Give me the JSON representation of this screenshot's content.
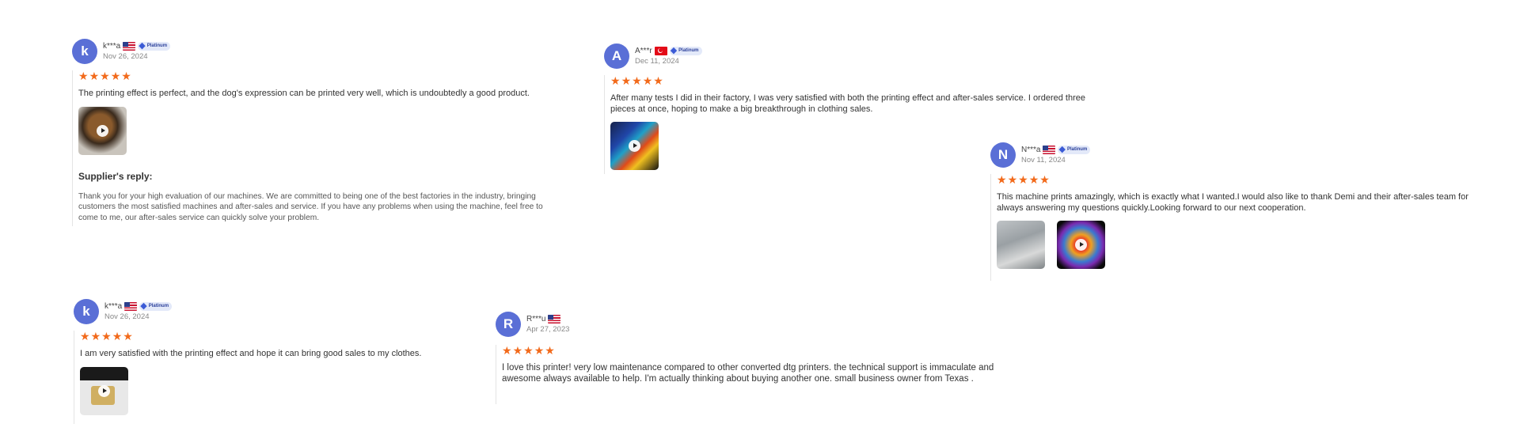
{
  "reviews": [
    {
      "avatar_letter": "k",
      "name": "k***a",
      "flag": "us-flag-icon",
      "badge": "Platinum",
      "date": "Nov 26, 2024",
      "rating": 5,
      "text": "The printing effect is perfect, and the dog's expression can be printed very well, which is undoubtedly a good product.",
      "reply": {
        "title": "Supplier's reply:",
        "text": "Thank you for your high evaluation of our machines. We are committed to being one of the best factories in the industry, bringing customers the most satisfied machines and after-sales and service. If you have any problems when using the machine, feel free to come to me, our after-sales service can quickly solve your problem."
      }
    },
    {
      "avatar_letter": "A",
      "name": "A***r",
      "flag": "turkey-flag-icon",
      "badge": "Platinum",
      "date": "Dec 11, 2024",
      "rating": 5,
      "text": "After many tests I did in their factory, I was very satisfied with both the printing effect and after-sales service. I ordered three pieces at once, hoping to make a big breakthrough in clothing sales."
    },
    {
      "avatar_letter": "N",
      "name": "N***a",
      "flag": "us-flag-icon",
      "badge": "Platinum",
      "date": "Nov 11, 2024",
      "rating": 5,
      "text": "This machine prints amazingly, which is exactly what I wanted.I would also like to thank Demi and their after-sales team for always answering my questions quickly.Looking forward to our next cooperation."
    },
    {
      "avatar_letter": "k",
      "name": "k***a",
      "flag": "us-flag-icon",
      "badge": "Platinum",
      "date": "Nov 26, 2024",
      "rating": 5,
      "text": "I am very satisfied with the printing effect and hope it can bring good sales to my clothes."
    },
    {
      "avatar_letter": "R",
      "name": "R***u",
      "flag": "us-flag-icon",
      "date": "Apr 27, 2023",
      "rating": 5,
      "text": "I love this printer! very low maintenance compared to other converted dtg printers. the technical support is immaculate and awesome always available to help. I'm actually thinking about buying another one. small business owner from Texas ."
    }
  ],
  "icons": {
    "star": "★",
    "gem": "◆"
  },
  "colors": {
    "avatar": "#5a6fd6",
    "star": "#f26a1b",
    "badge_bg": "#e3e9f9"
  }
}
